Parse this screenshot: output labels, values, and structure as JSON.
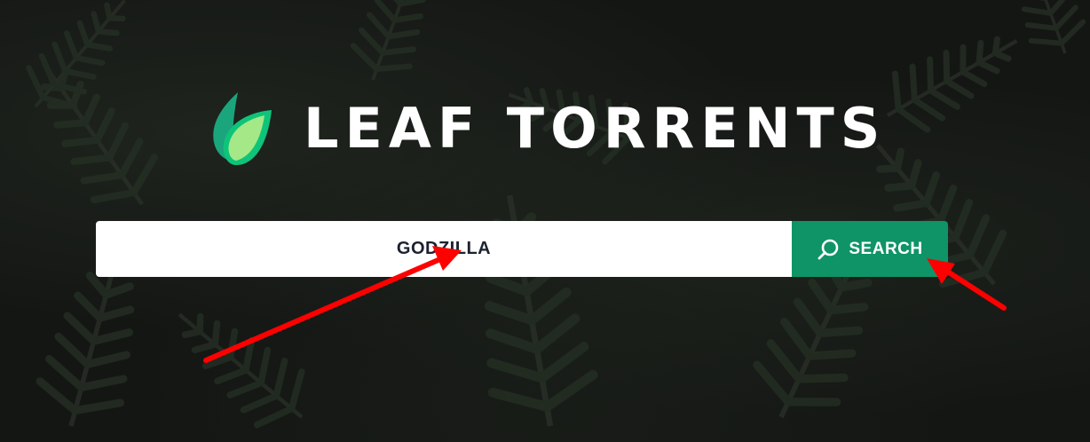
{
  "brand": {
    "name": "LEAF TORRENTS",
    "logo_icon": "leaf-icon",
    "leaf_colors": [
      "#1aa57d",
      "#0ec47a",
      "#a5e887"
    ]
  },
  "search": {
    "query": "GODZILLA",
    "button_label": "SEARCH",
    "button_icon": "search-icon",
    "button_color": "#0f9467"
  },
  "annotations": {
    "arrow_color": "#ff0000"
  }
}
